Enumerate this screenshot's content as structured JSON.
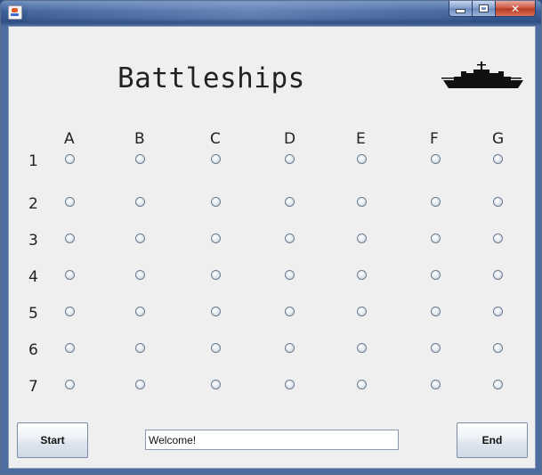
{
  "window": {
    "controls": {
      "minimize": "minimize",
      "maximize": "maximize",
      "close": "close"
    }
  },
  "app": {
    "title": "Battleships"
  },
  "grid": {
    "columns": [
      "A",
      "B",
      "C",
      "D",
      "E",
      "F",
      "G"
    ],
    "rows": [
      "1",
      "2",
      "3",
      "4",
      "5",
      "6",
      "7"
    ]
  },
  "footer": {
    "start_label": "Start",
    "status_text": "Welcome!",
    "end_label": "End"
  },
  "colors": {
    "title_bar": "#2f4f86",
    "panel": "#efefef",
    "ship": "#111111"
  },
  "icons": {
    "ship": "battleship-silhouette-icon",
    "app": "java-cup-icon"
  }
}
